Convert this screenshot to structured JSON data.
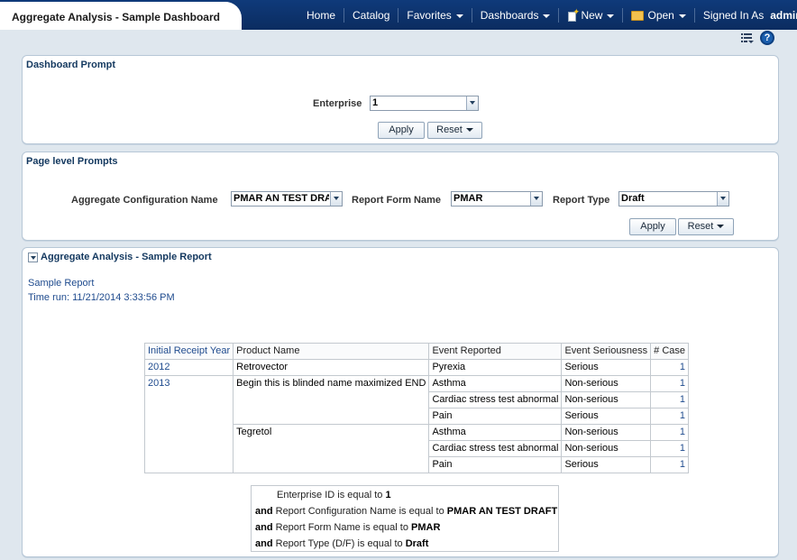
{
  "app": {
    "title": "Aggregate Analysis - Sample Dashboard"
  },
  "nav": {
    "home": "Home",
    "catalog": "Catalog",
    "favorites": "Favorites",
    "dashboards": "Dashboards",
    "new": "New",
    "open": "Open",
    "signed_in_as": "Signed In As",
    "user": "admin"
  },
  "dashboard_prompt": {
    "title": "Dashboard Prompt",
    "enterprise_label": "Enterprise",
    "enterprise_value": "1",
    "apply": "Apply",
    "reset": "Reset"
  },
  "page_prompts": {
    "title": "Page level Prompts",
    "config_label": "Aggregate Configuration Name",
    "config_value": "PMAR AN TEST DRAFT",
    "form_label": "Report Form Name",
    "form_value": "PMAR",
    "type_label": "Report Type",
    "type_value": "Draft",
    "apply": "Apply",
    "reset": "Reset"
  },
  "report": {
    "title": "Aggregate Analysis - Sample Report",
    "name": "Sample Report",
    "time_run": "Time run:  11/21/2014 3:33:56 PM",
    "columns": [
      "Initial Receipt Year",
      "Product Name",
      "Event Reported",
      "Event Seriousness",
      "# Case"
    ],
    "rows": [
      {
        "year": "2012",
        "product": "Retrovector",
        "event": "Pyrexia",
        "seriousness": "Serious",
        "cases": "1"
      },
      {
        "year": "2013",
        "product": "Begin this is blinded name maximized END",
        "event": "Asthma",
        "seriousness": "Non-serious",
        "cases": "1"
      },
      {
        "year": "",
        "product": "",
        "event": "Cardiac stress test abnormal",
        "seriousness": "Non-serious",
        "cases": "1"
      },
      {
        "year": "",
        "product": "",
        "event": "Pain",
        "seriousness": "Serious",
        "cases": "1"
      },
      {
        "year": "",
        "product": "Tegretol",
        "event": "Asthma",
        "seriousness": "Non-serious",
        "cases": "1"
      },
      {
        "year": "",
        "product": "",
        "event": "Cardiac stress test abnormal",
        "seriousness": "Non-serious",
        "cases": "1"
      },
      {
        "year": "",
        "product": "",
        "event": "Pain",
        "seriousness": "Serious",
        "cases": "1"
      }
    ],
    "filters": [
      {
        "prefix": "",
        "text": "Enterprise ID is equal to ",
        "value": "1"
      },
      {
        "prefix": "and",
        "text": " Report Configuration Name is equal to ",
        "value": "PMAR AN TEST DRAFT"
      },
      {
        "prefix": "and",
        "text": " Report Form Name is equal to ",
        "value": "PMAR"
      },
      {
        "prefix": "and",
        "text": " Report Type (D/F) is equal to ",
        "value": "Draft"
      }
    ]
  },
  "icons": {
    "list": "list-icon",
    "help": "help-icon",
    "new": "new-document-icon",
    "open": "open-folder-icon",
    "collapse": "collapse-icon"
  }
}
